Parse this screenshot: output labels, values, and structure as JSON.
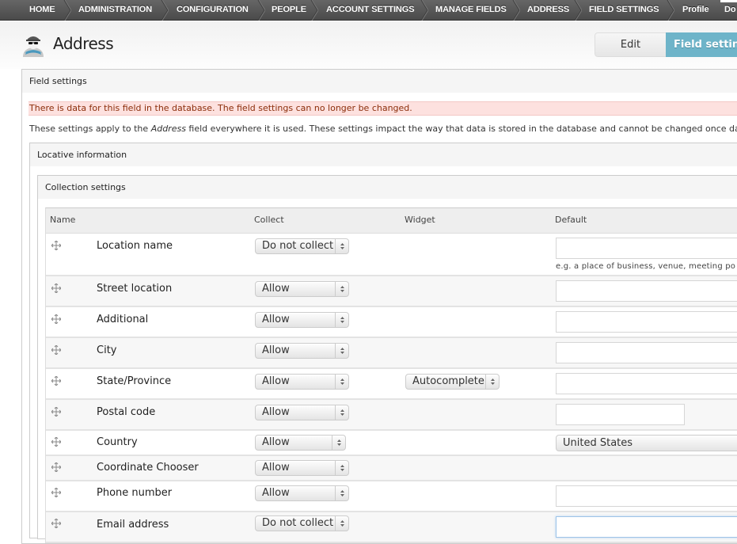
{
  "toolbar": {
    "breadcrumbs": [
      {
        "label": "HOME"
      },
      {
        "label": "ADMINISTRATION"
      },
      {
        "label": "CONFIGURATION"
      },
      {
        "label": "PEOPLE"
      },
      {
        "label": "ACCOUNT SETTINGS"
      },
      {
        "label": "MANAGE FIELDS"
      },
      {
        "label": "ADDRESS"
      },
      {
        "label": "FIELD SETTINGS"
      }
    ],
    "profile_label": "Profile",
    "truncated_label": "Do"
  },
  "header": {
    "avatar_icon": "user-avatar-icon",
    "title": "Address",
    "tabs": [
      {
        "label": "Edit",
        "active": false
      },
      {
        "label": "Field settings",
        "active": true
      }
    ]
  },
  "field_settings": {
    "legend": "Field settings",
    "error_message": "There is data for this field in the database. The field settings can no longer be changed.",
    "description_before": "These settings apply to the ",
    "description_em": "Address",
    "description_after": " field everywhere it is used. These settings impact the way that data is stored in the database and cannot be changed once data has",
    "locative": {
      "legend": "Locative information",
      "collection": {
        "legend": "Collection settings",
        "columns": {
          "name": "Name",
          "collect": "Collect",
          "widget": "Widget",
          "default": "Default"
        },
        "rows": [
          {
            "name": "Location name",
            "collect": "Do not collect",
            "widget": "",
            "default": "",
            "help": "e.g. a place of business, venue, meeting po"
          },
          {
            "name": "Street location",
            "collect": "Allow",
            "widget": "",
            "default": ""
          },
          {
            "name": "Additional",
            "collect": "Allow",
            "widget": "",
            "default": ""
          },
          {
            "name": "City",
            "collect": "Allow",
            "widget": "",
            "default": ""
          },
          {
            "name": "State/Province",
            "collect": "Allow",
            "widget": "Autocomplete",
            "default": ""
          },
          {
            "name": "Postal code",
            "collect": "Allow",
            "widget": "",
            "default": ""
          },
          {
            "name": "Country",
            "collect": "Allow",
            "widget": "",
            "default": "United States"
          },
          {
            "name": "Coordinate Chooser",
            "collect": "Allow",
            "widget": "",
            "default": ""
          },
          {
            "name": "Phone number",
            "collect": "Allow",
            "widget": "",
            "default": ""
          },
          {
            "name": "Email address",
            "collect": "Do not collect",
            "widget": "",
            "default": ""
          }
        ]
      }
    }
  }
}
